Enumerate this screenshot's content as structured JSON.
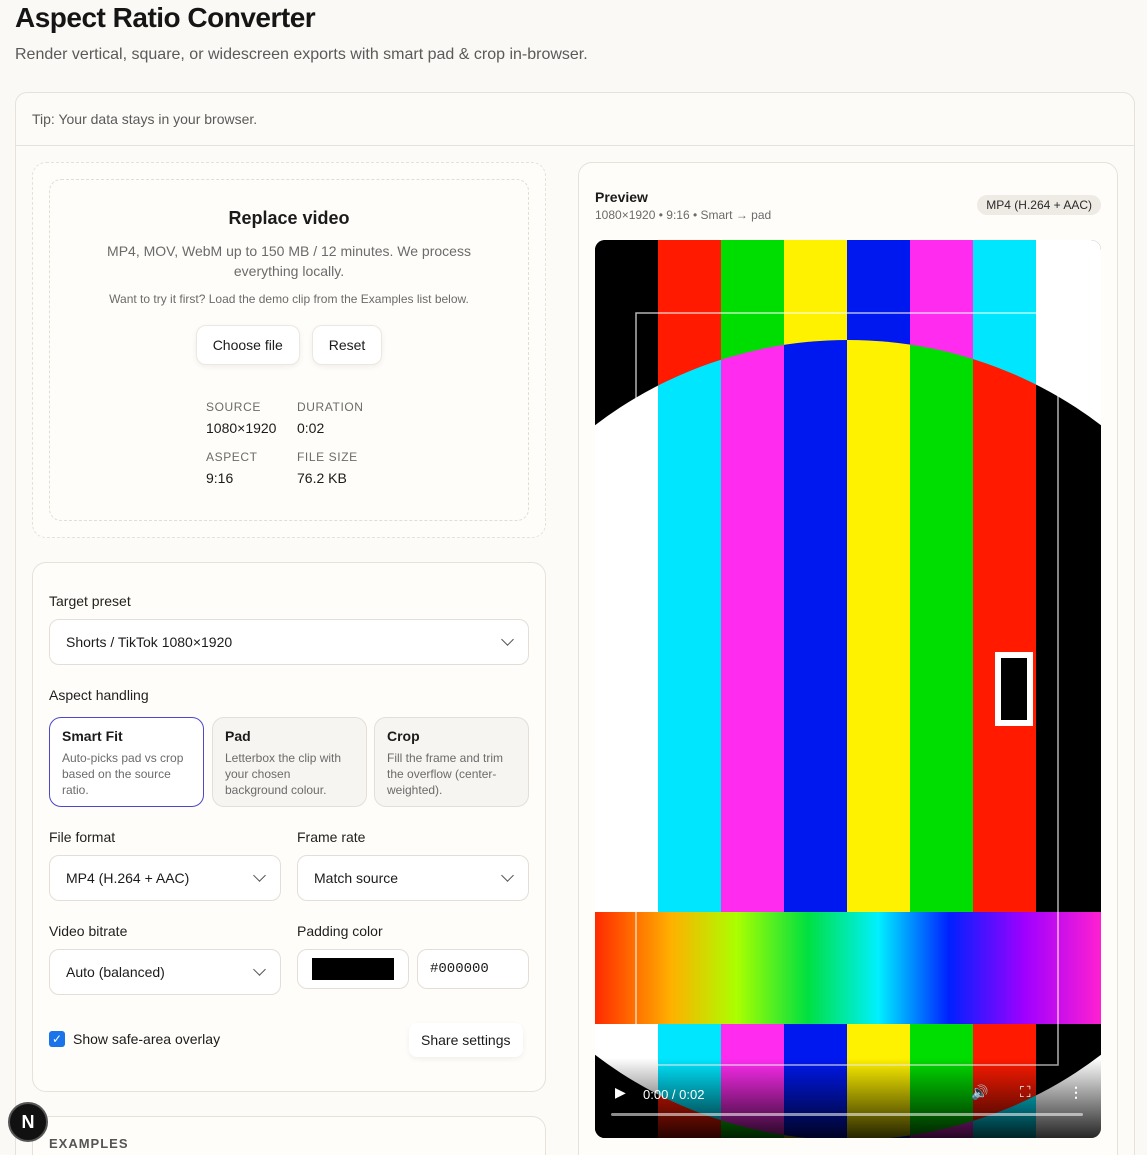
{
  "app": {
    "title": "Aspect Ratio Converter",
    "subtitle": "Render vertical, square, or widescreen exports with smart pad & crop in-browser.",
    "tip": "Tip: Your data stays in your browser."
  },
  "upload": {
    "heading": "Replace video",
    "description": "MP4, MOV, WebM up to 150 MB / 12 minutes. We process everything locally.",
    "hint": "Want to try it first? Load the demo clip from the Examples list below.",
    "choose_label": "Choose file",
    "reset_label": "Reset",
    "meta": {
      "source_key": "SOURCE",
      "source_val": "1080×1920",
      "duration_key": "DURATION",
      "duration_val": "0:02",
      "aspect_key": "ASPECT",
      "aspect_val": "9:16",
      "size_key": "FILE SIZE",
      "size_val": "76.2 KB"
    }
  },
  "settings": {
    "target_label": "Target preset",
    "target_value": "Shorts / TikTok 1080×1920",
    "aspect_label": "Aspect handling",
    "options": [
      {
        "title": "Smart Fit",
        "desc": "Auto-picks pad vs crop based on the source ratio."
      },
      {
        "title": "Pad",
        "desc": "Letterbox the clip with your chosen background colour."
      },
      {
        "title": "Crop",
        "desc": "Fill the frame and trim the overflow (center-weighted)."
      }
    ],
    "selected_option": "Smart Fit",
    "format_label": "File format",
    "format_value": "MP4 (H.264 + AAC)",
    "fps_label": "Frame rate",
    "fps_value": "Match source",
    "bitrate_label": "Video bitrate",
    "bitrate_value": "Auto (balanced)",
    "padding_label": "Padding color",
    "padding_hex": "#000000",
    "safe_area_label": "Show safe-area overlay",
    "safe_area_checked": true,
    "share_label": "Share settings"
  },
  "examples": {
    "heading": "EXAMPLES"
  },
  "preview": {
    "title": "Preview",
    "subtitle": "1080×1920 • 9:16 • Smart → pad",
    "badge": "MP4 (H.264 + AAC)",
    "time": "0:00 / 0:02",
    "progress": 0
  },
  "corner_badge": "N",
  "colors": {
    "accent": "#4b48c9",
    "checkbox": "#1a73e8",
    "padding": "#000000"
  },
  "icons": [
    "play-icon",
    "volume-icon",
    "fullscreen-icon",
    "more-icon",
    "chevron-down-icon"
  ]
}
